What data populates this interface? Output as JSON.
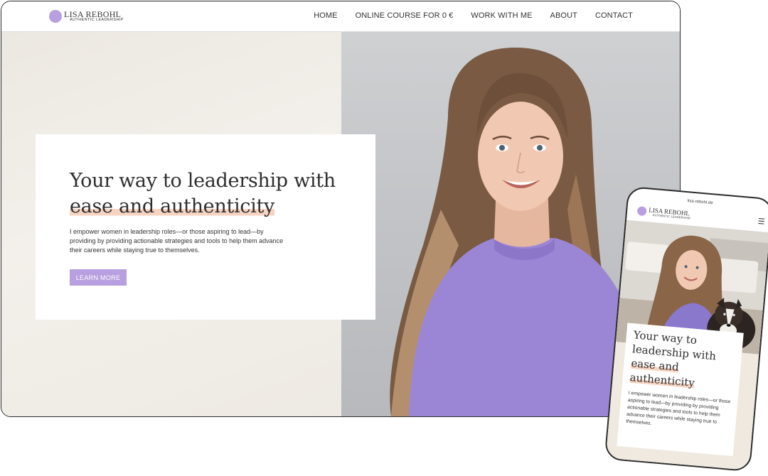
{
  "site": {
    "logo_name": "LISA REBOHL",
    "logo_tagline": "AUTHENTIC LEADERSHIP"
  },
  "nav": {
    "items": [
      {
        "label": "HOME"
      },
      {
        "label": "ONLINE COURSE FOR 0 €"
      },
      {
        "label": "WORK WITH ME"
      },
      {
        "label": "ABOUT"
      },
      {
        "label": "CONTACT"
      }
    ]
  },
  "hero": {
    "title_line1": "Your way to leadership with",
    "title_highlight": "ease and authenticity",
    "description": "I empower women in leadership roles—or those aspiring to lead—by providing by providing actionable strategies and tools to help them advance their careers while staying true to themselves.",
    "button_label": "LEARN MORE"
  },
  "mobile": {
    "url": "lisa-rebohl.de",
    "menu_icon": "hamburger-icon",
    "title_line1": "Your way to",
    "title_line2": "leadership with",
    "title_highlight1": "ease and",
    "title_highlight2": "authenticity",
    "description": "I empower women in leadership roles—or those aspiring to lead—by providing by providing actionable strategies and tools to help them advance their careers while staying true to themselves."
  },
  "colors": {
    "accent": "#b89fdf",
    "highlight": "#f7d3c2",
    "sweater": "#9b86d6"
  }
}
